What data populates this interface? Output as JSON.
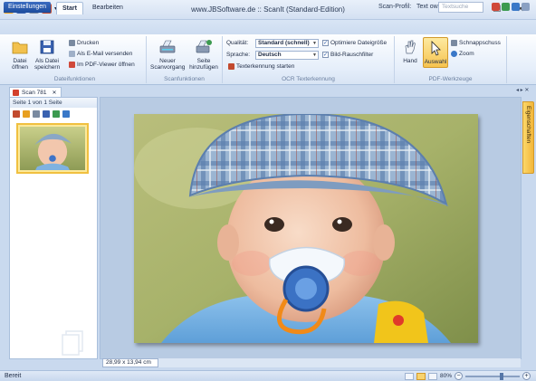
{
  "window": {
    "title": "www.JBSoftware.de :: ScanIt (Standard-Edition)",
    "minimize_glyph": "–",
    "maximize_glyph": "☐",
    "close_glyph": "✕"
  },
  "tabs": {
    "app_button": "Einstellungen",
    "items": [
      "Start",
      "Bearbeiten"
    ],
    "active": "Start"
  },
  "scan_profile": {
    "label": "Scan-Profil:",
    "value": "Text ow",
    "search_placeholder": "Textsuche"
  },
  "ribbon": {
    "dateifunktionen": {
      "label": "Dateifunktionen",
      "open": "Datei öffnen",
      "save_as": "Als Datei speichern",
      "print": "Drucken",
      "email": "Als E-Mail versenden",
      "pdf_viewer": "Im PDF-Viewer öffnen"
    },
    "scanfunktionen": {
      "label": "Scanfunktionen",
      "new_scan": "Neuer Scanvorgang",
      "add_page": "Seite hinzufügen"
    },
    "ocr": {
      "label": "OCR Texterkennung",
      "quality_label": "Qualität:",
      "quality_value": "Standard (schnell)",
      "language_label": "Sprache:",
      "language_value": "Deutsch",
      "optimize_size": "Optimiere Dateigröße",
      "noise_filter": "Bild-Rauschfilter",
      "start_ocr": "Texterkennung starten"
    },
    "pdf_tools": {
      "label": "PDF-Werkzeuge",
      "hand": "Hand",
      "select": "Auswahl",
      "snapshot": "Schnappschuss",
      "zoom": "Zoom"
    }
  },
  "document_tab": {
    "label": "Scan 781",
    "close_glyph": "✕"
  },
  "left_pane": {
    "header": "Seite 1 von 1 Seite"
  },
  "side_tab": {
    "label": "Eigenschaften"
  },
  "canvas": {
    "size_readout": "28,99 x 13,94 cm"
  },
  "status": {
    "text": "Bereit",
    "zoom": "80%"
  },
  "colors": {
    "accent": "#1c4c9e",
    "ribbon_bg": "#e5eefa",
    "highlight": "#f8d36f"
  },
  "icons": {
    "open": "folder-icon",
    "save": "floppy-icon",
    "print": "printer-icon",
    "email": "mail-icon",
    "pdf": "pdf-icon",
    "scan": "scanner-icon",
    "add_page": "add-page-icon",
    "hand": "hand-icon",
    "select": "cursor-icon",
    "snapshot": "camera-icon",
    "zoom": "magnifier-icon"
  }
}
